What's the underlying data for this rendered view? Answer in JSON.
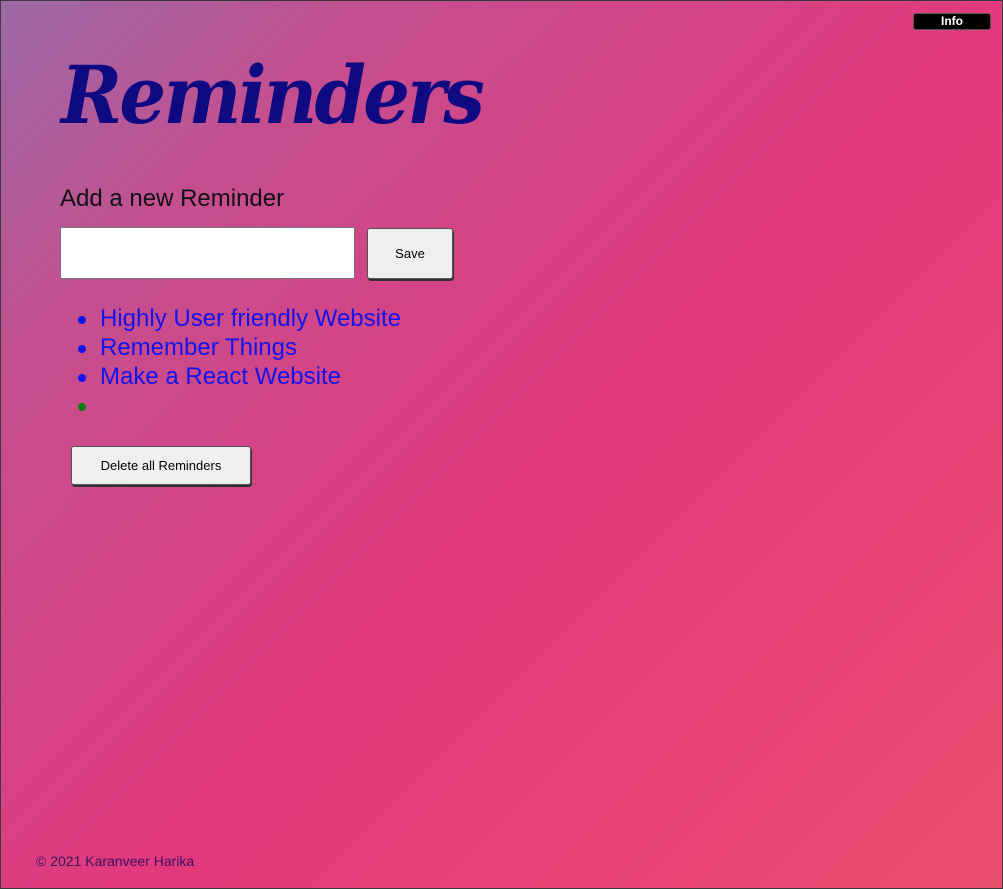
{
  "header": {
    "info_label": "Info",
    "title": "Reminders"
  },
  "form": {
    "label": "Add a new Reminder",
    "input_value": "",
    "input_placeholder": "",
    "save_label": "Save"
  },
  "reminders": [
    {
      "text": "Highly User friendly Website"
    },
    {
      "text": "Remember Things"
    },
    {
      "text": "Make a React Website"
    },
    {
      "text": ""
    }
  ],
  "actions": {
    "delete_all_label": "Delete all Reminders"
  },
  "footer": {
    "copyright": "© 2021 Karanveer Harika"
  },
  "colors": {
    "title": "#0f0a82",
    "link_text": "#1313ee",
    "empty_bullet": "#0a7d12",
    "gradient_start": "#9b69a6",
    "gradient_mid": "#e3397c",
    "gradient_end": "#e9506c"
  }
}
